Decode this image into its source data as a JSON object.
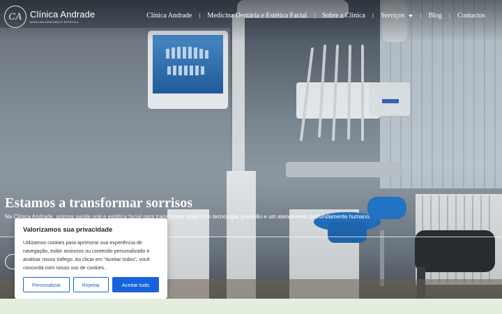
{
  "brand": {
    "monogram": "CA",
    "name": "Clínica Andrade",
    "tagline": "MEDICINA DENTÁRIA E ESTÉTICA"
  },
  "nav": {
    "items": [
      {
        "label": "Clínica Andrade"
      },
      {
        "label": "Medicina Dentária e Estética Facial"
      },
      {
        "label": "Sobre a Clínica"
      },
      {
        "label": "Serviços",
        "has_dropdown": true
      },
      {
        "label": "Blog"
      },
      {
        "label": "Contactos"
      }
    ],
    "separator": "|"
  },
  "hero": {
    "title": "Estamos a transformar sorrisos",
    "subtitle": "Na Clínica Andrade, unimos saúde oral e estética facial para transformar vidas com tecnologia, precisão e um atendimento profundamente humano."
  },
  "cookie_banner": {
    "title": "Valorizamos sua privacidade",
    "text": "Utilizamos cookies para aprimorar sua experiência de navegação, exibir anúncios ou conteúdo personalizado e analisar nosso tráfego. Ao clicar em “Aceitar todos”, você concorda com nosso uso de cookies.",
    "customize_label": "Personalizar",
    "reject_label": "Rejeitar",
    "accept_label": "Aceitar tudo"
  },
  "colors": {
    "accent": "#1863dc",
    "bottom_strip": "#e4eedf"
  }
}
